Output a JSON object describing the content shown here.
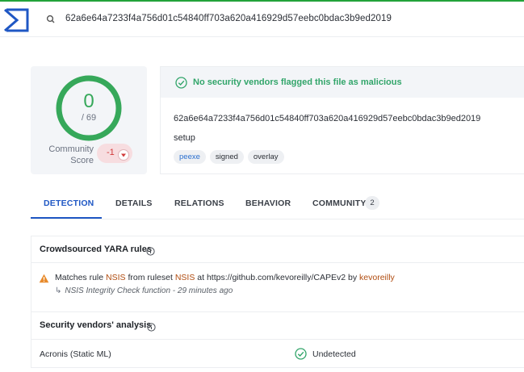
{
  "search": {
    "query": "62a6e64a7233f4a756d01c54840ff703a620a416929d57eebc0bdac3b9ed2019"
  },
  "score": {
    "detections": "0",
    "total": "/ 69",
    "community_label": "Community Score",
    "community_value": "-1"
  },
  "summary": {
    "banner": "No security vendors flagged this file as malicious",
    "hash": "62a6e64a7233f4a756d01c54840ff703a620a416929d57eebc0bdac3b9ed2019",
    "filename": "setup",
    "tags": [
      "peexe",
      "signed",
      "overlay"
    ]
  },
  "tabs": [
    {
      "label": "DETECTION",
      "active": true
    },
    {
      "label": "DETAILS"
    },
    {
      "label": "RELATIONS"
    },
    {
      "label": "BEHAVIOR"
    },
    {
      "label": "COMMUNITY",
      "count": "2"
    }
  ],
  "yara": {
    "title": "Crowdsourced YARA rules",
    "rule_prefix": "Matches rule",
    "rule_name": "NSIS",
    "ruleset_prefix": "from ruleset",
    "ruleset_name": "NSIS",
    "at_text": "at https://github.com/kevoreilly/CAPEv2 by",
    "author": "kevoreilly",
    "description": "NSIS Integrity Check function - 29 minutes ago"
  },
  "vendors": {
    "title": "Security vendors' analysis",
    "rows": [
      {
        "name": "Acronis (Static ML)",
        "result": "Undetected"
      }
    ]
  },
  "colors": {
    "accent": "#1f57c4",
    "clean": "#36a85a",
    "negative": "#d13a3a",
    "highlight": "#b04c10"
  }
}
